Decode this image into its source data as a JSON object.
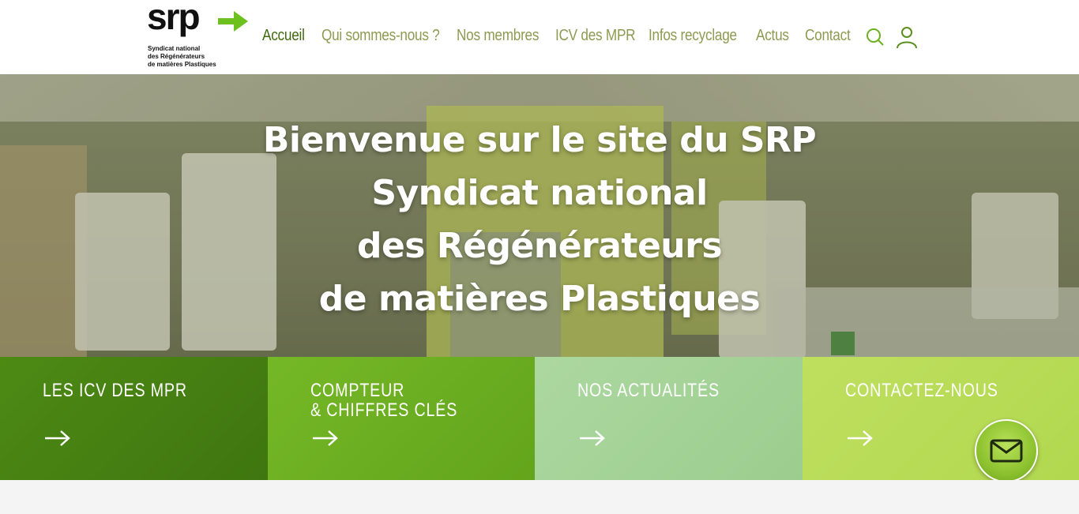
{
  "logo": {
    "word": "srp",
    "subtitle": [
      "Syndicat national",
      "des Régénérateurs",
      "de matières Plastiques"
    ],
    "arrow_color": "#6cc11f"
  },
  "nav": {
    "items": [
      {
        "label": "Accueil",
        "active": true
      },
      {
        "label": "Qui sommes-nous ?"
      },
      {
        "label": "Nos membres"
      },
      {
        "label": "ICV des MPR"
      },
      {
        "label": "Infos recyclage"
      },
      {
        "label": "Actus"
      },
      {
        "label": "Contact"
      }
    ],
    "active_color": "#3f6a12",
    "color": "#8e9a52"
  },
  "hero": {
    "lines": [
      "Bienvenue sur le site du SRP",
      "Syndicat national",
      "des Régénérateurs",
      "de matières Plastiques"
    ]
  },
  "tiles": [
    {
      "lines": [
        "LES ICV DES MPR"
      ],
      "color": "#4e8a15"
    },
    {
      "lines": [
        "COMPTEUR",
        "& CHIFFRES CLÉS"
      ],
      "color": "#6fb424"
    },
    {
      "lines": [
        "NOS ACTUALITÉS"
      ],
      "color": "#a6d59a"
    },
    {
      "lines": [
        "CONTACTEZ-NOUS"
      ],
      "color": "#b8dc5a"
    }
  ],
  "icons": {
    "search": "search-icon",
    "user": "user-icon",
    "arrow": "arrow-right-icon",
    "mail": "mail-icon"
  }
}
